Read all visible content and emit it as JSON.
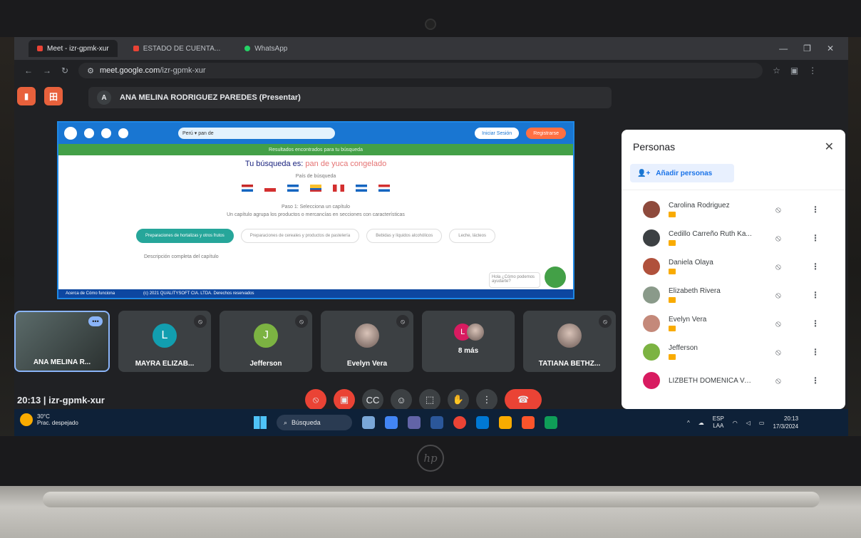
{
  "browser": {
    "tabs": [
      {
        "label": "Meet - izr-gpmk-xur",
        "active": true,
        "color": "#ea4335"
      },
      {
        "label": "ESTADO DE CUENTA...",
        "active": false,
        "color": "#ea4335"
      },
      {
        "label": "WhatsApp",
        "active": false,
        "color": "#25d366"
      }
    ],
    "url": "meet.google.com",
    "url_path": "/izr-gpmk-xur"
  },
  "meet": {
    "presenter_initial": "A",
    "presenter_label": "ANA MELINA RODRIGUEZ PAREDES (Presentar)",
    "meeting_time": "20:13",
    "meeting_code": "izr-gpmk-xur",
    "participants_badge": "14"
  },
  "presentation": {
    "search_text": "Perú ▾  pan de",
    "login_label": "Iniciar Sesión",
    "register_label": "Registrarse",
    "banner_text": "Resultados encontrados para tu búsqueda",
    "search_title_prefix": "Tu búsqueda es:",
    "search_title_value": "pan de yuca congelado",
    "country_label": "País de búsqueda",
    "step_label": "Paso 1: Selecciona un capítulo",
    "step_sub": "Un capítulo agrupa los productos o mercancías en secciones con características",
    "buttons": [
      "Preparaciones de hortalizas y otros frutos",
      "Preparaciones de cereales y productos de pastelería",
      "Bebidas y líquidos alcohólicos",
      "Leche, lácteos"
    ],
    "description_label": "Descripción completa del capítulo",
    "footer_left": "Acerca de   Cómo funciona",
    "footer_center": "(c) 2021 QUALITYSOFT CIA. LTDA. Derechos reservados",
    "chat_text": "Hola ¿Cómo podemos ayudarte?"
  },
  "tiles": [
    {
      "name": "ANA MELINA R...",
      "initial": "",
      "color": "#4a5a58",
      "self": true
    },
    {
      "name": "MAYRA ELIZAB...",
      "initial": "L",
      "color": "#129eaf",
      "self": false
    },
    {
      "name": "Jefferson",
      "initial": "J",
      "color": "#7cb342",
      "self": false
    },
    {
      "name": "Evelyn Vera",
      "initial": "",
      "color": "photo",
      "self": false
    },
    {
      "name": "8 más",
      "initial": "L",
      "color": "#d81b60",
      "self": false
    },
    {
      "name": "TATIANA BETHZ...",
      "initial": "",
      "color": "photo",
      "self": false
    }
  ],
  "people_panel": {
    "title": "Personas",
    "add_label": "Añadir personas",
    "people": [
      {
        "name": "Carolina Rodriguez",
        "color": "#8e4a3c"
      },
      {
        "name": "Cedillo Carreño Ruth Ka...",
        "color": "#3c4043"
      },
      {
        "name": "Daniela Olaya",
        "color": "#b0513c"
      },
      {
        "name": "Elizabeth Rivera",
        "color": "#8a9a8a"
      },
      {
        "name": "Evelyn Vera",
        "color": "#c4897a"
      },
      {
        "name": "Jefferson",
        "color": "#7cb342"
      },
      {
        "name": "LIZBETH DOMENICA VA...",
        "color": "#d81b60"
      }
    ]
  },
  "taskbar": {
    "weather_temp": "30°C",
    "weather_desc": "Prac. despejado",
    "search_label": "Búsqueda",
    "lang_top": "ESP",
    "lang_bottom": "LAA",
    "clock_time": "20:13",
    "clock_date": "17/3/2024"
  },
  "laptop_brand": "hp"
}
